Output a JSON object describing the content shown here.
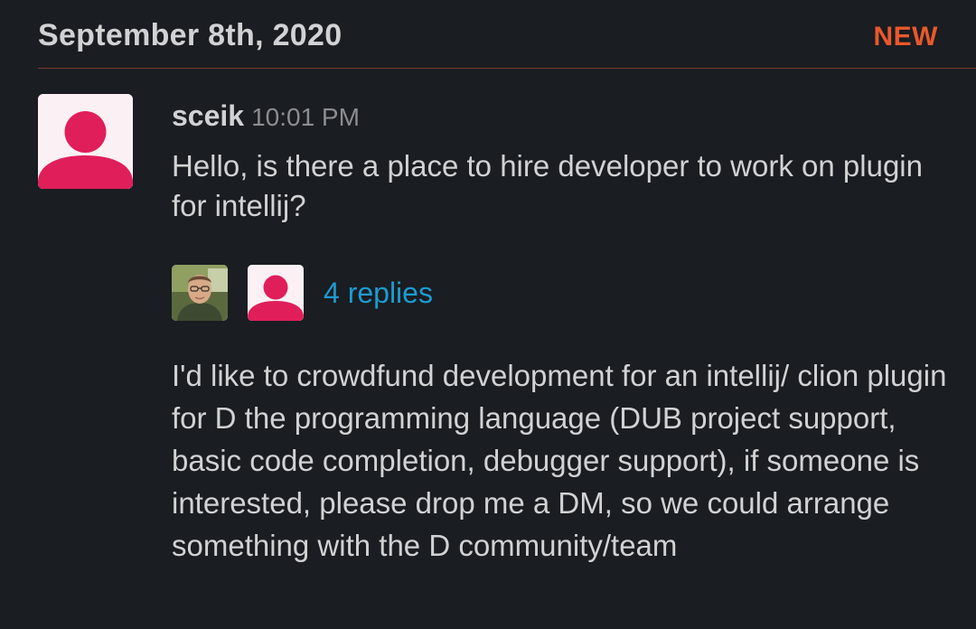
{
  "day_divider": {
    "date": "September 8th, 2020",
    "new_label": "NEW"
  },
  "message": {
    "sender": "sceik",
    "time": "10:01 PM",
    "text": "Hello, is there a place to hire developer to work on plugin for intellij?",
    "thread": {
      "replies_label": "4 replies",
      "participants": [
        "photo-avatar",
        "default-avatar"
      ]
    }
  },
  "followup": {
    "text": "I'd like to crowdfund development for an intellij/ clion plugin for D the programming language (DUB project support, basic code completion, debugger support), if someone is interested, please drop me a DM, so we could arrange something with the D community/team"
  },
  "colors": {
    "background": "#1a1d21",
    "text": "#d1d2d3",
    "new_accent": "#e8582c",
    "link": "#1d9bd1",
    "avatar_pink": "#e01e5a"
  }
}
